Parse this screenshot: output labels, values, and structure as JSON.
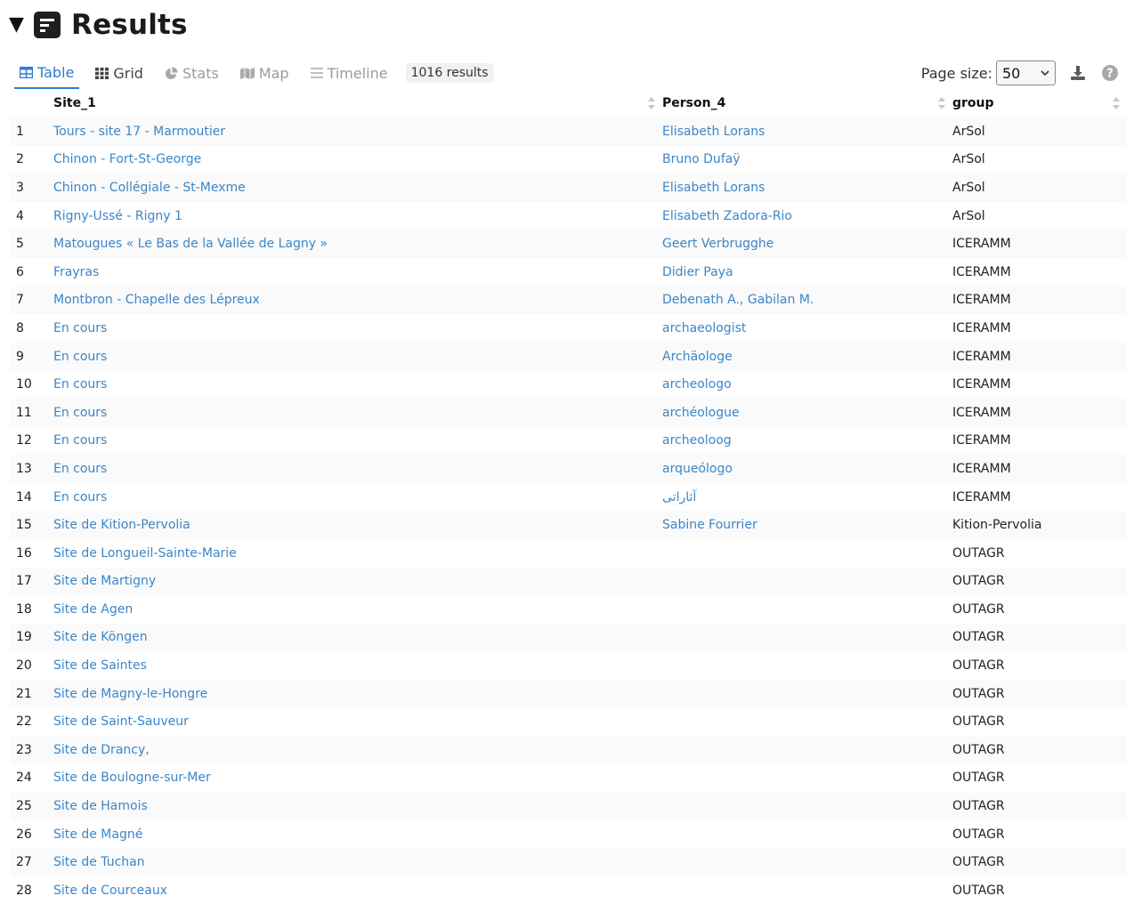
{
  "header": {
    "title": "Results"
  },
  "tabs": [
    {
      "label": "Table",
      "icon": "table-icon",
      "active": true
    },
    {
      "label": "Grid",
      "icon": "grid-icon",
      "active": false
    },
    {
      "label": "Stats",
      "icon": "pie-chart-icon",
      "active": false
    },
    {
      "label": "Map",
      "icon": "map-icon",
      "active": false
    },
    {
      "label": "Timeline",
      "icon": "list-lines-icon",
      "active": false
    }
  ],
  "results_count": "1016 results",
  "toolbar": {
    "page_size_label": "Page size:",
    "page_size_value": "50"
  },
  "table": {
    "columns": [
      "Site_1",
      "Person_4",
      "group"
    ],
    "rows": [
      {
        "n": "1",
        "site": "Tours - site 17 - Marmoutier",
        "person": "Elisabeth Lorans",
        "group": "ArSol"
      },
      {
        "n": "2",
        "site": "Chinon - Fort-St-George",
        "person": "Bruno Dufaÿ",
        "group": "ArSol"
      },
      {
        "n": "3",
        "site": "Chinon - Collégiale - St-Mexme",
        "person": "Elisabeth Lorans",
        "group": "ArSol"
      },
      {
        "n": "4",
        "site": "Rigny-Ussé - Rigny 1",
        "person": "Elisabeth Zadora-Rio",
        "group": "ArSol"
      },
      {
        "n": "5",
        "site": "Matougues « Le Bas de la Vallée de Lagny »",
        "person": "Geert Verbrugghe",
        "group": "ICERAMM"
      },
      {
        "n": "6",
        "site": "Frayras",
        "person": "Didier Paya",
        "group": "ICERAMM"
      },
      {
        "n": "7",
        "site": "Montbron - Chapelle des Lépreux",
        "person": "Debenath A., Gabilan M.",
        "group": "ICERAMM"
      },
      {
        "n": "8",
        "site": "En cours",
        "person": "archaeologist",
        "group": "ICERAMM"
      },
      {
        "n": "9",
        "site": "En cours",
        "person": "Archäologe",
        "group": "ICERAMM"
      },
      {
        "n": "10",
        "site": "En cours",
        "person": "archeologo",
        "group": "ICERAMM"
      },
      {
        "n": "11",
        "site": "En cours",
        "person": "archéologue",
        "group": "ICERAMM"
      },
      {
        "n": "12",
        "site": "En cours",
        "person": "archeoloog",
        "group": "ICERAMM"
      },
      {
        "n": "13",
        "site": "En cours",
        "person": "arqueólogo",
        "group": "ICERAMM"
      },
      {
        "n": "14",
        "site": "En cours",
        "person": "آثاراتی",
        "group": "ICERAMM"
      },
      {
        "n": "15",
        "site": "Site de Kition-Pervolia",
        "person": "Sabine Fourrier",
        "group": "Kition-Pervolia"
      },
      {
        "n": "16",
        "site": "Site de Longueil-Sainte-Marie",
        "person": "",
        "group": "OUTAGR"
      },
      {
        "n": "17",
        "site": "Site de Martigny",
        "person": "",
        "group": "OUTAGR"
      },
      {
        "n": "18",
        "site": "Site de Agen",
        "person": "",
        "group": "OUTAGR"
      },
      {
        "n": "19",
        "site": "Site de Köngen",
        "person": "",
        "group": "OUTAGR"
      },
      {
        "n": "20",
        "site": "Site de Saintes",
        "person": "",
        "group": "OUTAGR"
      },
      {
        "n": "21",
        "site": "Site de Magny-le-Hongre",
        "person": "",
        "group": "OUTAGR"
      },
      {
        "n": "22",
        "site": "Site de Saint-Sauveur",
        "person": "",
        "group": "OUTAGR"
      },
      {
        "n": "23",
        "site": "Site de Drancy,",
        "person": "",
        "group": "OUTAGR"
      },
      {
        "n": "24",
        "site": "Site de Boulogne-sur-Mer",
        "person": "",
        "group": "OUTAGR"
      },
      {
        "n": "25",
        "site": "Site de Hamois",
        "person": "",
        "group": "OUTAGR"
      },
      {
        "n": "26",
        "site": "Site de Magné",
        "person": "",
        "group": "OUTAGR"
      },
      {
        "n": "27",
        "site": "Site de Tuchan",
        "person": "",
        "group": "OUTAGR"
      },
      {
        "n": "28",
        "site": "Site de Courceaux",
        "person": "",
        "group": "OUTAGR"
      }
    ]
  },
  "colors": {
    "accent": "#2b7bd3",
    "link": "#3b86c8",
    "muted": "#9b9b9b"
  }
}
